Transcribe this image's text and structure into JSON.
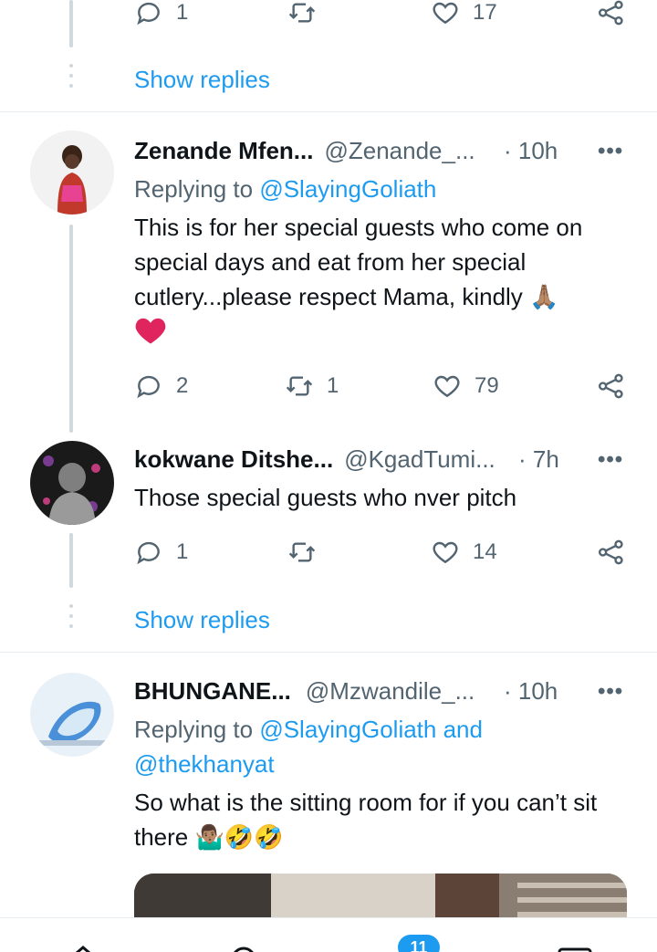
{
  "top_tweet": {
    "reply_count": "1",
    "retweet_count": "",
    "like_count": "17",
    "show_replies": "Show replies"
  },
  "tweets": [
    {
      "display_name": "Zenande Mfen...",
      "handle": "@Zenande_...",
      "time": "· 10h",
      "replying_prefix": "Replying to ",
      "replying_to": "@SlayingGoliath",
      "text": "This is for her special guests who come on special days and eat from her special cutlery...please respect Mama, kindly",
      "emoji_inline": "🙏🏽",
      "emoji_trailing": "❤️",
      "reply_count": "2",
      "retweet_count": "1",
      "like_count": "79"
    },
    {
      "display_name": "kokwane Ditshe...",
      "handle": "@KgadTumi...",
      "time": "· 7h",
      "text": "Those special guests who nver pitch",
      "reply_count": "1",
      "retweet_count": "",
      "like_count": "14",
      "show_replies": "Show replies"
    },
    {
      "display_name": "BHUNGANE...",
      "handle": "@Mzwandile_...",
      "time": "· 10h",
      "replying_prefix": "Replying to ",
      "replying_to_1": "@SlayingGoliath and",
      "replying_to_2": "@thekhanyat",
      "text": "So what is the sitting room for if you can’t sit there",
      "emoji": "🤷🏽‍♂️🤣🤣"
    }
  ],
  "more_label": "•••",
  "nav": {
    "notifications_badge": "11"
  },
  "colors": {
    "accent": "#1d9bf0",
    "secondary_text": "#536471",
    "heart": "#e0245e"
  }
}
